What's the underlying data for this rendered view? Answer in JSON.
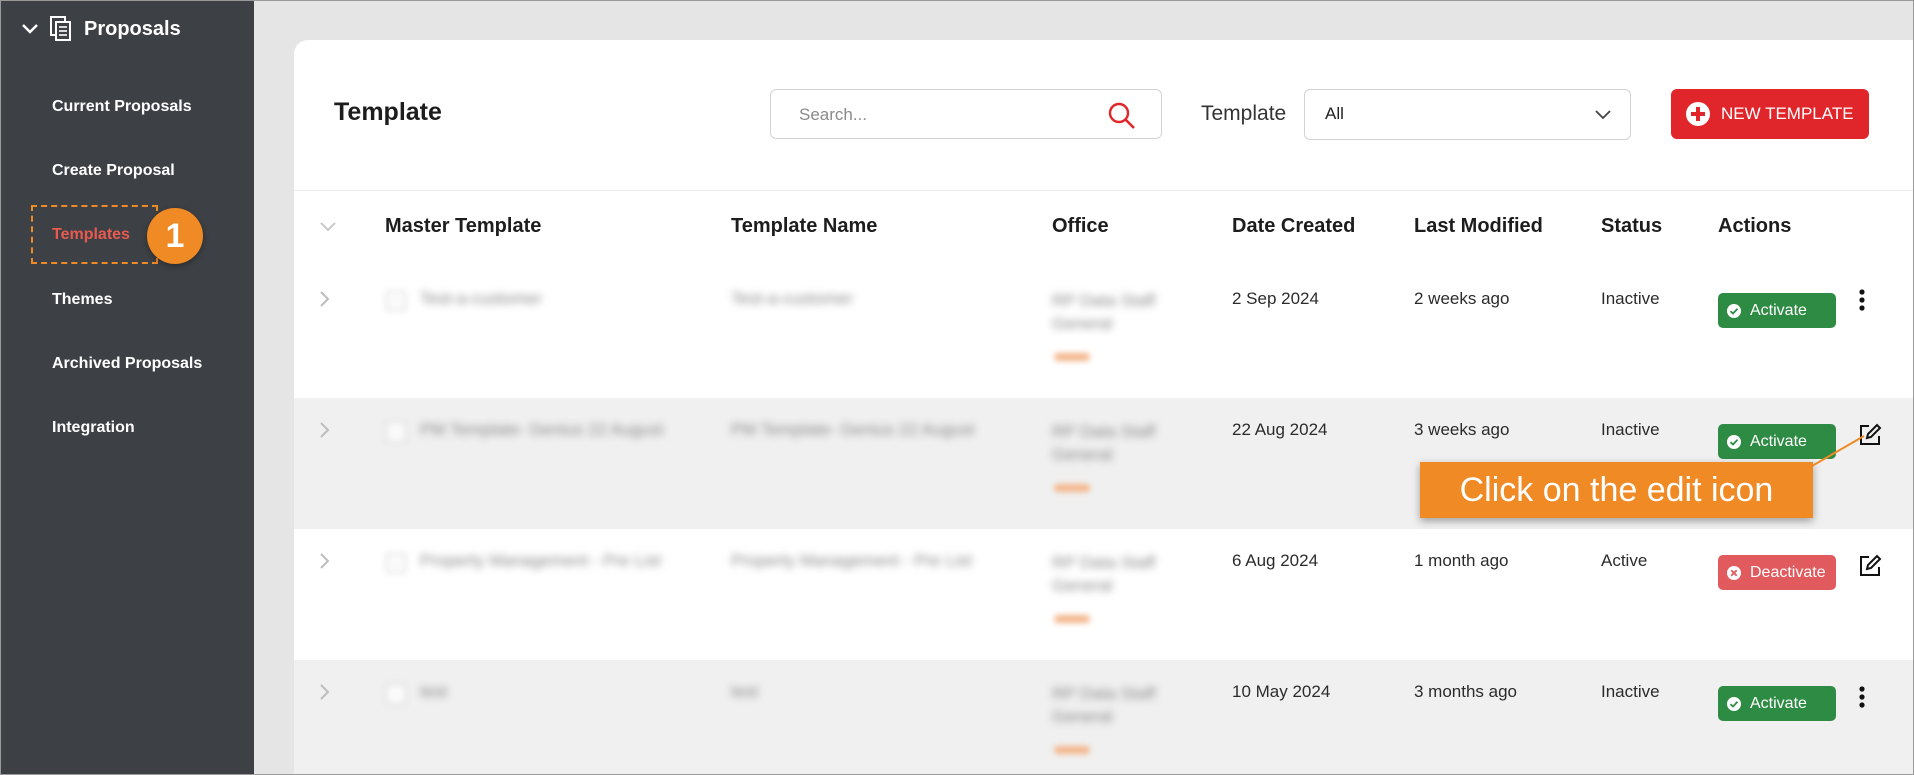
{
  "sidebar": {
    "section_title": "Proposals",
    "items": [
      {
        "label": "Current Proposals"
      },
      {
        "label": "Create Proposal"
      },
      {
        "label": "Templates"
      },
      {
        "label": "Themes"
      },
      {
        "label": "Archived Proposals"
      },
      {
        "label": "Integration"
      }
    ],
    "active_item": "Templates",
    "step_badge": "1"
  },
  "header": {
    "title": "Template",
    "search_placeholder": "Search...",
    "filter_label": "Template",
    "filter_value": "All",
    "new_button_label": "NEW TEMPLATE"
  },
  "table": {
    "columns": [
      "Master Template",
      "Template Name",
      "Office",
      "Date Created",
      "Last Modified",
      "Status",
      "Actions"
    ],
    "rows": [
      {
        "master": "Test-a-customer",
        "name": "Test-a-customer",
        "office": "RP Data Staff General",
        "date_created": "2 Sep 2024",
        "last_modified": "2 weeks ago",
        "status": "Inactive",
        "action": "Activate"
      },
      {
        "master": "PM Template- Genius 22 August",
        "name": "PM Template- Genius 22 August",
        "office": "RP Data Staff General",
        "date_created": "22 Aug 2024",
        "last_modified": "3 weeks ago",
        "status": "Inactive",
        "action": "Activate"
      },
      {
        "master": "Property Management - Pre List",
        "name": "Property Management - Pre List",
        "office": "RP Data Staff General",
        "date_created": "6 Aug 2024",
        "last_modified": "1 month ago",
        "status": "Active",
        "action": "Deactivate"
      },
      {
        "master": "test",
        "name": "test",
        "office": "RP Data Staff General",
        "date_created": "10 May 2024",
        "last_modified": "3 months ago",
        "status": "Inactive",
        "action": "Activate"
      }
    ]
  },
  "callout": {
    "text": "Click on the edit icon"
  },
  "colors": {
    "sidebar_bg": "#3d4045",
    "accent_red": "#e0262a",
    "callout_orange": "#f08a24",
    "active_green": "#2e8b44"
  }
}
